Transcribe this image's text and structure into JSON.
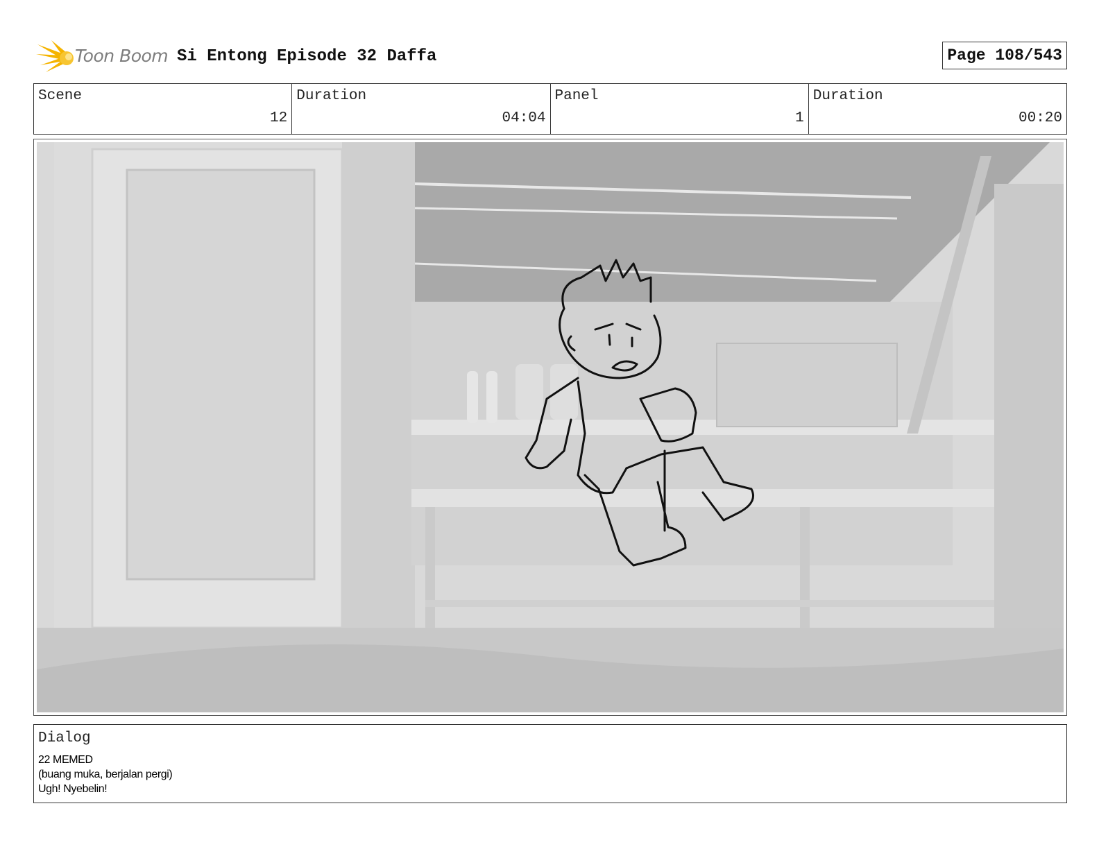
{
  "header": {
    "logo_text": "Toon Boom",
    "project_title": "Si Entong Episode 32 Daffa",
    "page_label": "Page 108/543"
  },
  "info": {
    "scene_label": "Scene",
    "scene_value": "12",
    "scene_duration_label": "Duration",
    "scene_duration_value": "04:04",
    "panel_label": "Panel",
    "panel_value": "1",
    "panel_duration_label": "Duration",
    "panel_duration_value": "00:20"
  },
  "panel": {
    "image": "storyboard-sketch-boy-running-interior"
  },
  "dialog": {
    "label": "Dialog",
    "lines": [
      "22 MEMED",
      "(buang muka, berjalan pergi)",
      "Ugh! Nyebelin!"
    ]
  },
  "colors": {
    "logo_yellow": "#f5b400",
    "logo_text_gray": "#7d7d7d",
    "border": "#333333",
    "scene_gray": "#d8d8d8"
  }
}
